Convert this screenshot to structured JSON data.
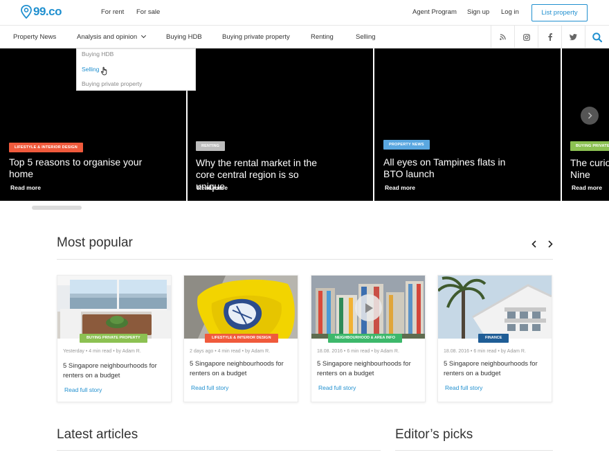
{
  "brand": {
    "name": "99.co",
    "color": "#1f8fcf",
    "logo_icon": "map-pin-icon"
  },
  "top_nav": {
    "left_links": [
      "For rent",
      "For sale"
    ],
    "right_links": [
      "Agent Program",
      "Sign up",
      "Log in"
    ],
    "cta_label": "List property"
  },
  "main_nav": {
    "items": [
      "Property News",
      "Analysis and opinion",
      "Buying HDB",
      "Buying private property",
      "Renting",
      "Selling"
    ],
    "social_icons": [
      "rss-icon",
      "instagram-icon",
      "facebook-icon",
      "twitter-icon"
    ],
    "search_icon": "search-icon"
  },
  "dropdown": {
    "items": [
      "Buying HDB",
      "Selling",
      "Buying private property"
    ],
    "active_index": 1
  },
  "hero": {
    "slides": [
      {
        "badge": "LIFESTYLE & INTERIOR DESIGN",
        "badge_color": "#f05a3c",
        "title": "Top 5 reasons to organise your home",
        "cta": "Read more"
      },
      {
        "badge": "RENTING",
        "badge_color": "#bdbdbd",
        "title": "Why the rental market in the core central region is so unique",
        "cta": "Read more"
      },
      {
        "badge": "PROPERTY NEWS",
        "badge_color": "#5aa7e0",
        "title": "All eyes on Tampines flats in BTO launch",
        "cta": "Read more"
      },
      {
        "badge": "BUYING PRIVATE",
        "badge_color": "#8cc152",
        "title": "The curio Nine",
        "cta": "Read more"
      }
    ],
    "next_icon": "chevron-right-icon"
  },
  "most_popular": {
    "title": "Most popular",
    "prev_icon": "chevron-left-icon",
    "next_icon": "chevron-right-icon",
    "cards": [
      {
        "badge": "BUYING PRIVATE PROPERTY",
        "badge_color": "#8cc152",
        "meta": "Yesterday  •  4 min read  •  by Adam R.",
        "title": "5 Singapore neighbourhoods for renters on a budget",
        "cta": "Read full story"
      },
      {
        "badge": "LIFESTYLE & INTERIOR DESIGN",
        "badge_color": "#f05a3c",
        "meta": "2 days ago  •  4 min read  •  by Adam R.",
        "title": "5 Singapore neighbourhoods for renters on a budget",
        "cta": "Read full story"
      },
      {
        "badge": "NEIGHBOURHOOD & AREA INFO",
        "badge_color": "#3db86b",
        "meta": "18.08. 2016  •  6 min read  •  by Adam R.",
        "title": "5 Singapore neighbourhoods for renters on a budget",
        "cta": "Read full story",
        "play_icon": "play-icon"
      },
      {
        "badge": "FINANCE",
        "badge_color": "#1f5d96",
        "meta": "18.08. 2016  •  6 min read  •  by Adam R.",
        "title": "5 Singapore neighbourhoods for renters on a budget",
        "cta": "Read full story"
      }
    ]
  },
  "latest_articles": {
    "title": "Latest articles"
  },
  "editors_picks": {
    "title": "Editor’s picks"
  }
}
